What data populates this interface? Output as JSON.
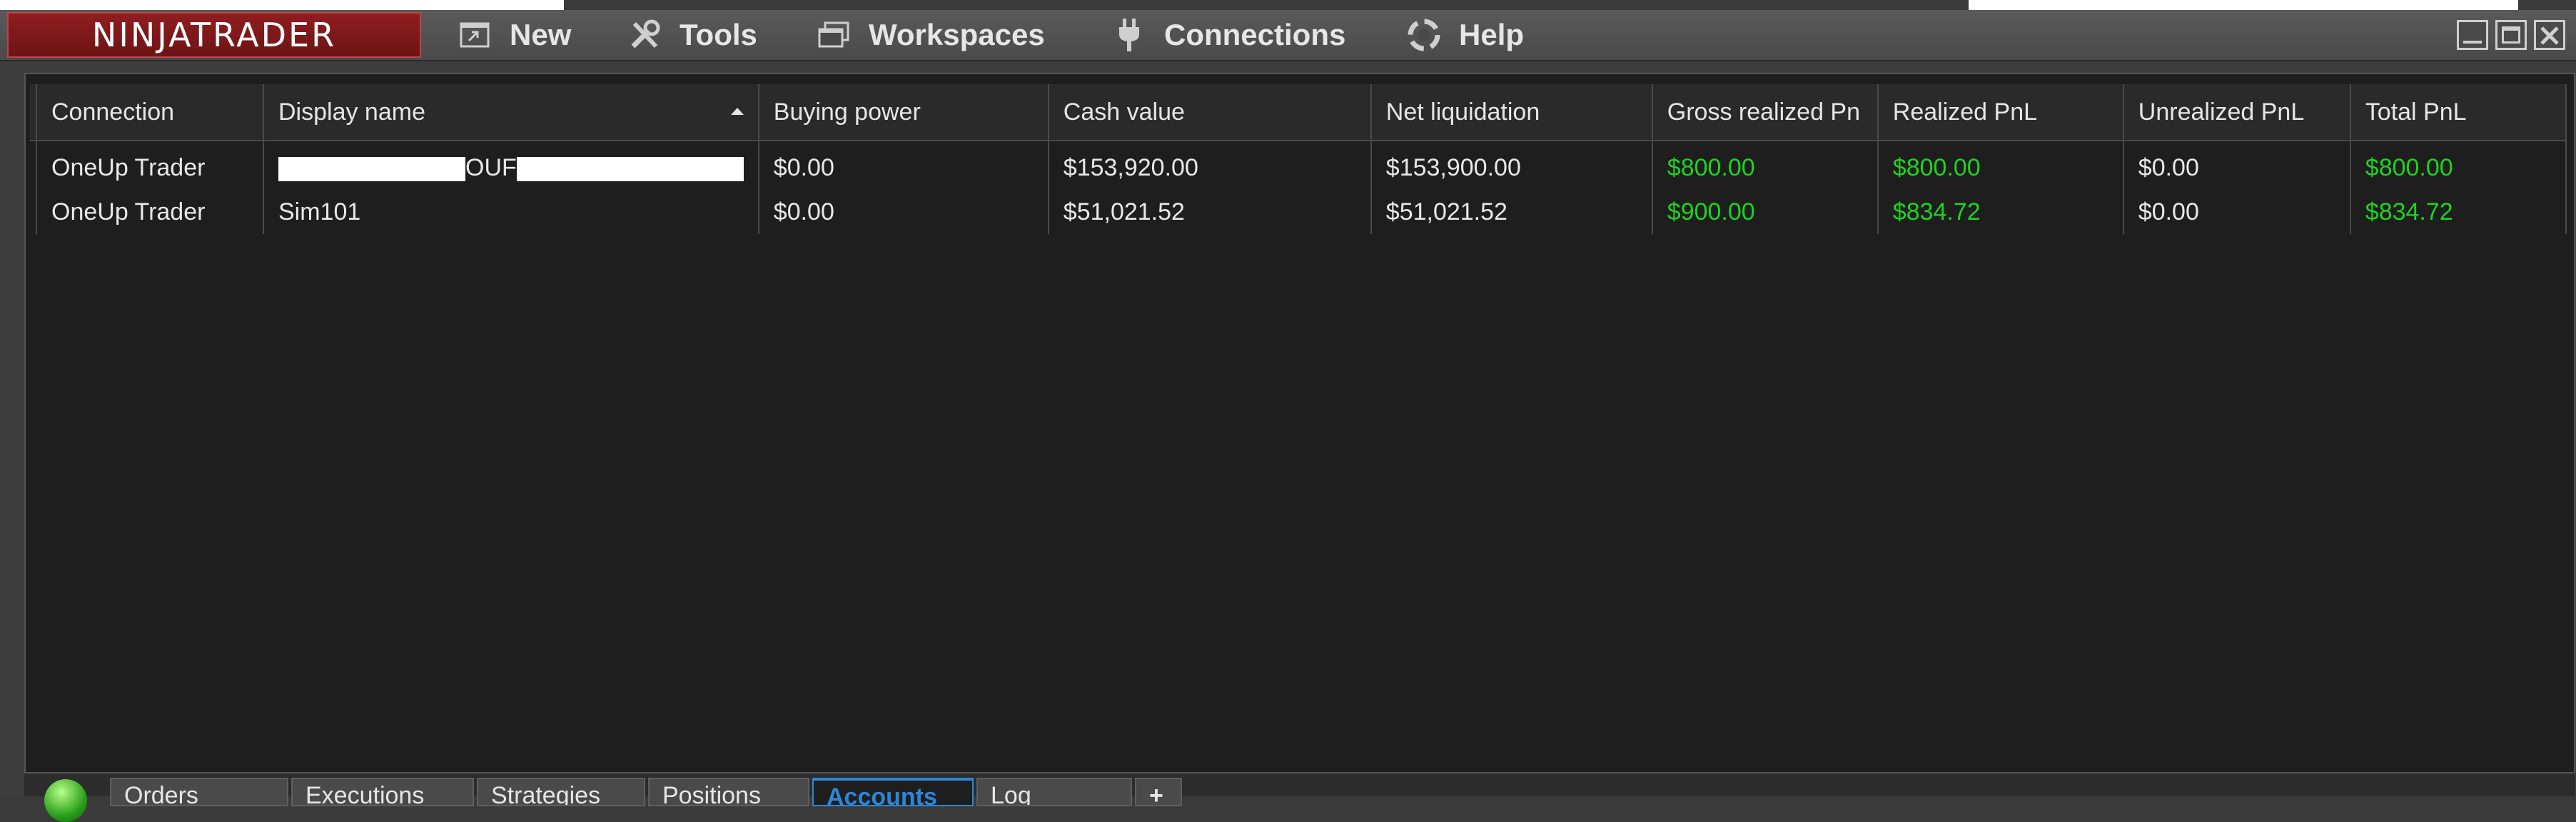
{
  "app": {
    "logo_text": "NINJATRADER"
  },
  "menu": [
    {
      "label": "New",
      "icon": "new-window-icon"
    },
    {
      "label": "Tools",
      "icon": "tools-icon"
    },
    {
      "label": "Workspaces",
      "icon": "workspaces-icon"
    },
    {
      "label": "Connections",
      "icon": "plug-icon"
    },
    {
      "label": "Help",
      "icon": "help-lifebuoy-icon"
    }
  ],
  "table": {
    "columns": [
      "Connection",
      "Display name",
      "Buying power",
      "Cash value",
      "Net liquidation",
      "Gross realized Pn",
      "Realized PnL",
      "Unrealized PnL",
      "Total PnL"
    ],
    "rows": [
      {
        "connection": "OneUp Trader",
        "display_name": "OUF",
        "buying_power": "$0.00",
        "cash_value": "$153,920.00",
        "net_liquidation": "$153,900.00",
        "gross_realized": "$800.00",
        "realized": "$800.00",
        "unrealized": "$0.00",
        "total": "$800.00"
      },
      {
        "connection": "OneUp Trader",
        "display_name": "Sim101",
        "buying_power": "$0.00",
        "cash_value": "$51,021.52",
        "net_liquidation": "$51,021.52",
        "gross_realized": "$900.00",
        "realized": "$834.72",
        "unrealized": "$0.00",
        "total": "$834.72"
      }
    ]
  },
  "tabs": [
    {
      "label": "Orders"
    },
    {
      "label": "Executions"
    },
    {
      "label": "Strategies"
    },
    {
      "label": "Positions"
    },
    {
      "label": "Accounts",
      "active": true
    },
    {
      "label": "Log"
    },
    {
      "label": "+"
    }
  ],
  "colors": {
    "positive": "#1fd31f",
    "accent": "#2e86d6",
    "logo": "#8f1d20"
  }
}
